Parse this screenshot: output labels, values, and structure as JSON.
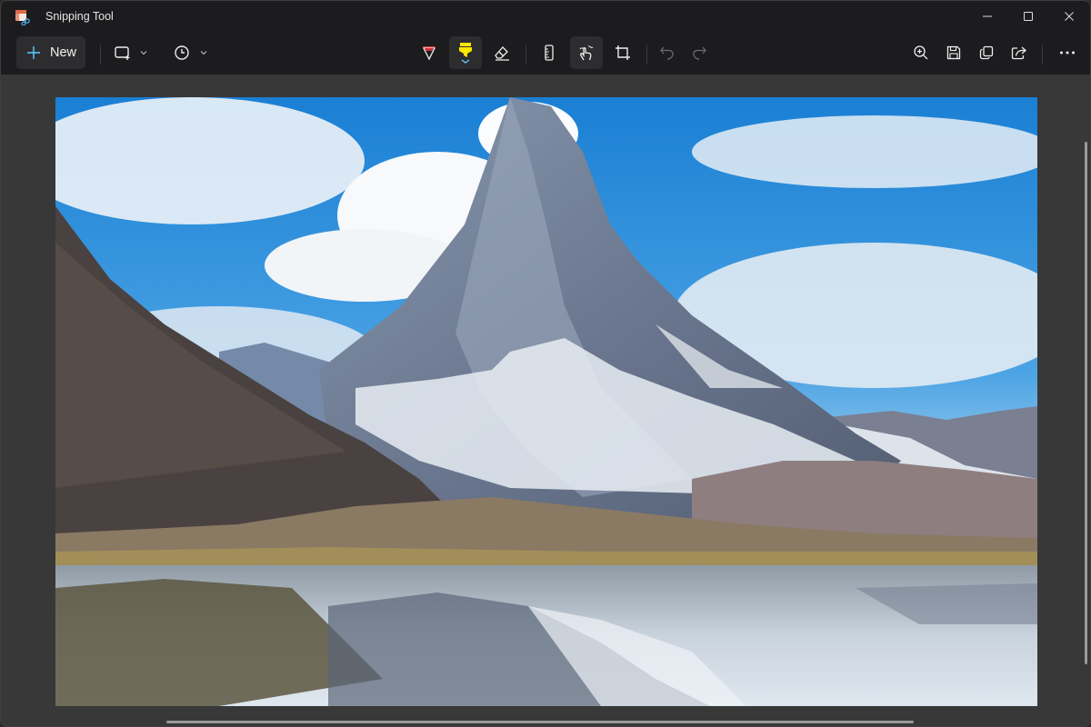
{
  "window": {
    "title": "Snipping Tool",
    "controls": {
      "minimize": "minimize",
      "maximize": "maximize",
      "close": "close"
    }
  },
  "toolbar": {
    "new_label": "New",
    "left_tools": [
      {
        "name": "snipping-mode",
        "icon": "rectangle-snip-icon",
        "has_dropdown": true
      },
      {
        "name": "delay",
        "icon": "clock-icon",
        "has_dropdown": true
      }
    ],
    "center_tools": [
      {
        "name": "ballpoint-pen",
        "icon": "pen-icon",
        "color": "#d13438"
      },
      {
        "name": "highlighter",
        "icon": "highlighter-icon",
        "color": "#ffe600",
        "selected": true
      },
      {
        "name": "eraser",
        "icon": "eraser-icon"
      },
      {
        "name": "ruler",
        "icon": "ruler-icon"
      },
      {
        "name": "touch-writing",
        "icon": "touch-writing-icon",
        "selected": true
      },
      {
        "name": "crop",
        "icon": "crop-icon"
      },
      {
        "name": "undo",
        "icon": "undo-icon",
        "enabled": false
      },
      {
        "name": "redo",
        "icon": "redo-icon",
        "enabled": false
      }
    ],
    "right_tools": [
      {
        "name": "zoom",
        "icon": "zoom-in-icon"
      },
      {
        "name": "save",
        "icon": "save-icon"
      },
      {
        "name": "copy",
        "icon": "copy-icon"
      },
      {
        "name": "share",
        "icon": "share-icon"
      },
      {
        "name": "more",
        "icon": "more-icon"
      }
    ]
  },
  "canvas": {
    "image_description": "Matterhorn mountain peak with clouds, reflected in an alpine lake",
    "colors": {
      "sky": "#1e86d6",
      "accent": "#60cdff"
    }
  }
}
